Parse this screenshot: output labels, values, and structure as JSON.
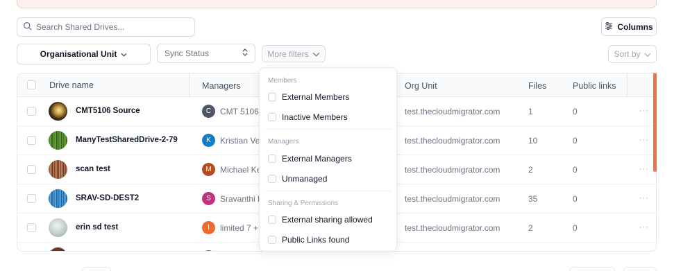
{
  "search": {
    "placeholder": "Search Shared Drives..."
  },
  "toolbar": {
    "columns_label": "Columns"
  },
  "filters": {
    "org_unit_label": "Organisational Unit",
    "sync_status_placeholder": "Sync Status",
    "more_filters_label": "More filters",
    "sort_by_label": "Sort by"
  },
  "table": {
    "headers": {
      "drive_name": "Drive name",
      "managers": "Managers",
      "org_unit": "Org Unit",
      "files": "Files",
      "public_links": "Public links"
    },
    "rows": [
      {
        "name": "CMT5106 Source",
        "manager_initial": "C",
        "manager_name": "CMT 5106",
        "manager_color": "#4b5563",
        "org_unit": "test.thecloudmigrator.com",
        "files": "1",
        "public_links": "0"
      },
      {
        "name": "ManyTestSharedDrive-2-79",
        "manager_initial": "K",
        "manager_name": "Kristian Ve",
        "manager_color": "#0b7fc9",
        "org_unit": "test.thecloudmigrator.com",
        "files": "10",
        "public_links": "0"
      },
      {
        "name": "scan test",
        "manager_initial": "M",
        "manager_name": "Michael Ke",
        "manager_color": "#b54a1f",
        "org_unit": "test.thecloudmigrator.com",
        "files": "2",
        "public_links": "0"
      },
      {
        "name": "SRAV-SD-DEST2",
        "manager_initial": "S",
        "manager_name": "Sravanthi K",
        "manager_color": "#c2307e",
        "org_unit": "test.thecloudmigrator.com",
        "files": "35",
        "public_links": "0"
      },
      {
        "name": "erin sd test",
        "manager_initial": "l",
        "manager_name": "limited 7",
        "manager_extra": "+",
        "manager_color": "#ef6a2b",
        "org_unit": "test.thecloudmigrator.com",
        "files": "2",
        "public_links": "0"
      }
    ],
    "row_actions": "···"
  },
  "more_filters_menu": {
    "groups": [
      {
        "label": "Members",
        "items": [
          "External Members",
          "Inactive Members"
        ]
      },
      {
        "label": "Managers",
        "items": [
          "External Managers",
          "Unmanaged"
        ]
      },
      {
        "label": "Sharing & Permissions",
        "items": [
          "External sharing allowed",
          "Public Links found"
        ]
      }
    ]
  },
  "icons": {
    "search": "search-icon",
    "columns": "sliders-icon",
    "chevron": "chevron-down-icon",
    "updown": "updown-chevron-icon",
    "row_actions": "ellipsis-icon"
  },
  "colors": {
    "accent_scroll": "#f0714a",
    "alert_bg": "#fdf1ef"
  }
}
